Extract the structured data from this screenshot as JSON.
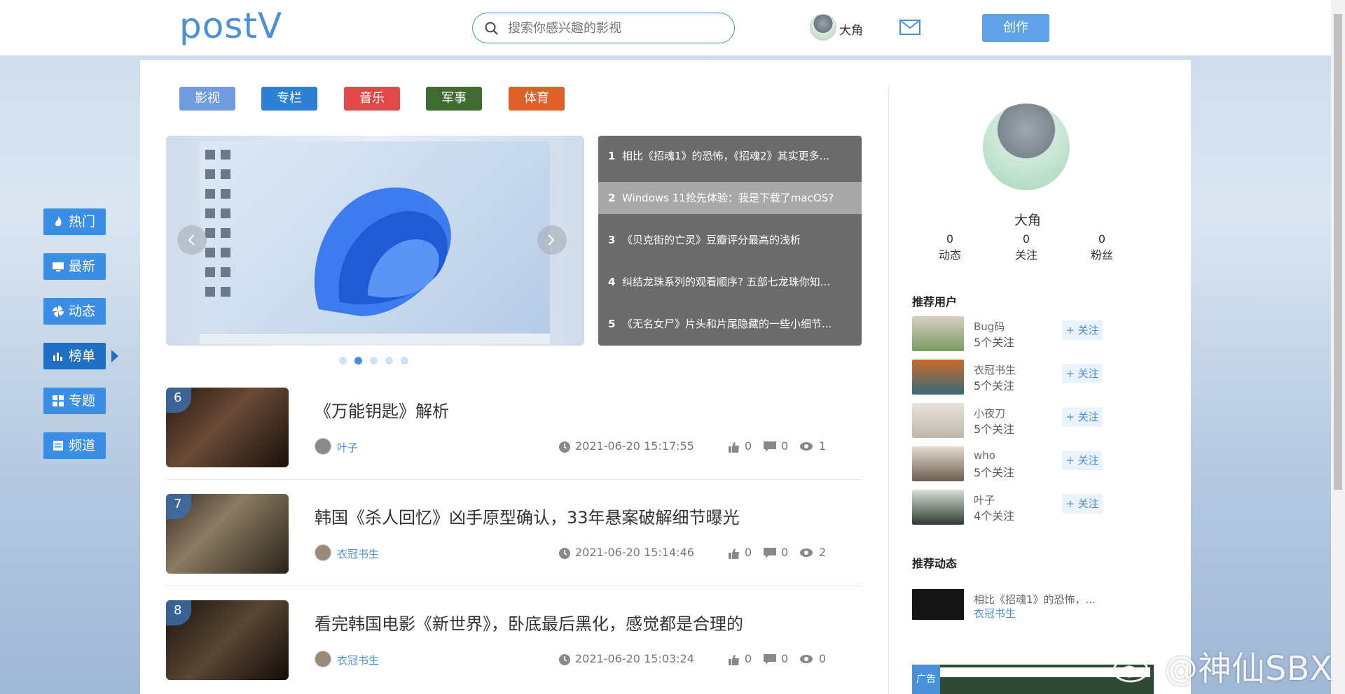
{
  "header": {
    "logo": "postV",
    "search_placeholder": "搜索你感兴趣的影视",
    "username": "大角",
    "create_label": "创作"
  },
  "leftnav": [
    {
      "label": "热门",
      "icon": "fire-icon"
    },
    {
      "label": "最新",
      "icon": "monitor-icon"
    },
    {
      "label": "动态",
      "icon": "pinwheel-icon"
    },
    {
      "label": "榜单",
      "icon": "bar-chart-icon",
      "active": true
    },
    {
      "label": "专题",
      "icon": "grid-icon"
    },
    {
      "label": "频道",
      "icon": "list-icon"
    }
  ],
  "categories": [
    {
      "label": "影视",
      "color": "#6f9be0"
    },
    {
      "label": "专栏",
      "color": "#2e80d6"
    },
    {
      "label": "音乐",
      "color": "#e24a4a"
    },
    {
      "label": "军事",
      "color": "#3e6b2f"
    },
    {
      "label": "体育",
      "color": "#e0602a"
    }
  ],
  "ranking": [
    {
      "num": "1",
      "title": "相比《招魂1》的恐怖，《招魂2》其实更多..."
    },
    {
      "num": "2",
      "title": "Windows 11抢先体验：我是下载了macOS?"
    },
    {
      "num": "3",
      "title": "《贝克街的亡灵》豆瓣评分最高的浅析"
    },
    {
      "num": "4",
      "title": "纠结龙珠系列的观看顺序? 五部七龙珠你知..."
    },
    {
      "num": "5",
      "title": "《无名女尸》片头和片尾隐藏的一些小细节..."
    }
  ],
  "carousel": {
    "active_index": 1,
    "count": 5
  },
  "articles": [
    {
      "rank": "6",
      "title": "《万能钥匙》解析",
      "author": "叶子",
      "time": "2021-06-20 15:17:55",
      "likes": "0",
      "comments": "0",
      "views": "1"
    },
    {
      "rank": "7",
      "title": "韩国《杀人回忆》凶手原型确认，33年悬案破解细节曝光",
      "author": "衣冠书生",
      "time": "2021-06-20 15:14:46",
      "likes": "0",
      "comments": "0",
      "views": "2"
    },
    {
      "rank": "8",
      "title": "看完韩国电影《新世界》，卧底最后黑化，感觉都是合理的",
      "author": "衣冠书生",
      "time": "2021-06-20 15:03:24",
      "likes": "0",
      "comments": "0",
      "views": "0"
    }
  ],
  "profile": {
    "name": "大角",
    "stats": [
      {
        "value": "0",
        "label": "动态"
      },
      {
        "value": "0",
        "label": "关注"
      },
      {
        "value": "0",
        "label": "粉丝"
      }
    ]
  },
  "recommended_users_title": "推荐用户",
  "recommended_users": [
    {
      "name": "Bug码",
      "follows": "5个关注",
      "follow_label": "+ 关注"
    },
    {
      "name": "衣冠书生",
      "follows": "5个关注",
      "follow_label": "+ 关注"
    },
    {
      "name": "小夜刀",
      "follows": "5个关注",
      "follow_label": "+ 关注"
    },
    {
      "name": "who",
      "follows": "5个关注",
      "follow_label": "+ 关注"
    },
    {
      "name": "叶子",
      "follows": "4个关注",
      "follow_label": "+ 关注"
    }
  ],
  "recommended_posts_title": "推荐动态",
  "recommended_posts": [
    {
      "title": "相比《招魂1》的恐怖，...",
      "author": "衣冠书生"
    }
  ],
  "ad_label": "广告",
  "watermark": "@神仙SBX"
}
